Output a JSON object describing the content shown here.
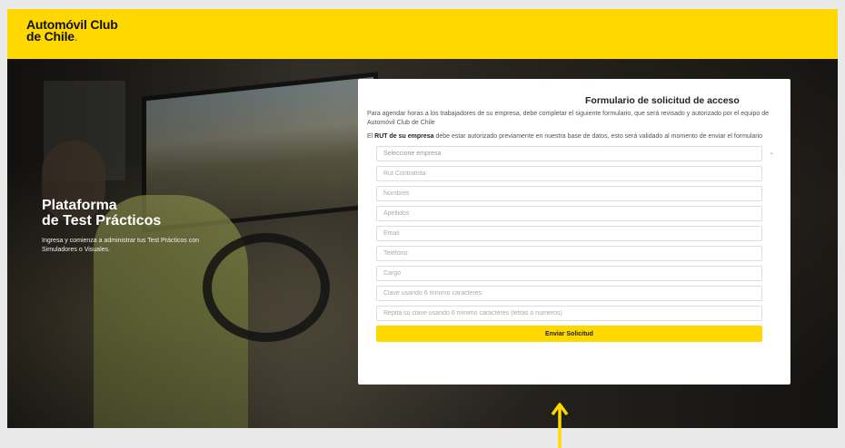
{
  "header": {
    "logo_line1": "Automóvil Club",
    "logo_line2": "de Chile",
    "logo_dot": "."
  },
  "hero": {
    "title_line1": "Plataforma",
    "title_line2": "de Test Prácticos",
    "subtitle": "Ingresa y comienza a administrar tus Test Prácticos con Simuladores o Visuales."
  },
  "form": {
    "title": "Formulario de solicitud de acceso",
    "intro": "Para agendar horas a los trabajadores de su empresa, debe completar el siguiente formulario, que será revisado y autorizado por el equipo de Automóvil Club de Chile",
    "rut_note_bold": "RUT de su empresa",
    "rut_note_prefix": "El ",
    "rut_note_rest": " debe estar autorizado previamente en nuestra base de datos, esto será validado al momento de enviar el formulario",
    "select_company": "Seleccione empresa",
    "fields": {
      "rut": "Rut Contratista",
      "nombres": "Nombres",
      "apellidos": "Apellidos",
      "email": "Email",
      "telefono": "Teléfono",
      "cargo": "Cargo",
      "clave": "Clave usando 6 mínimo caracteres",
      "repita": "Repita su clave usando 6 mínimo caracteres (letras o números)"
    },
    "submit_label": "Enviar Solicitud"
  },
  "colors": {
    "brand_yellow": "#ffd800",
    "arrow": "#ffd800"
  },
  "icons": {
    "select_chevron": "chevron-down-icon",
    "annotation_arrow": "arrow-up-icon"
  }
}
